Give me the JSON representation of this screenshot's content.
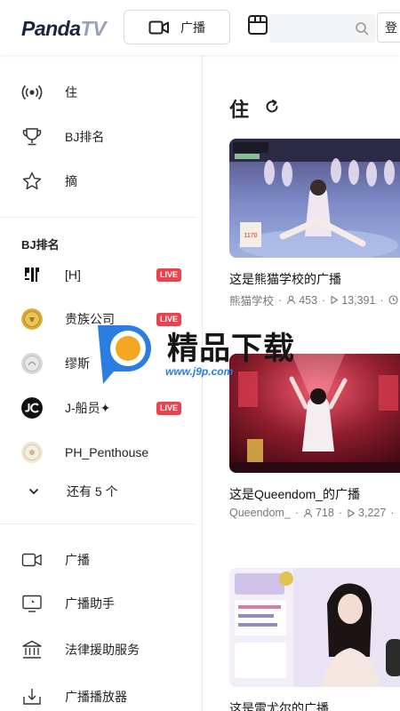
{
  "header": {
    "logo": {
      "part1": "Panda",
      "part2": "TV"
    },
    "broadcast_label": "广播",
    "search_placeholder": "",
    "login_label": "登"
  },
  "sidebar": {
    "nav_top": [
      {
        "label": "住",
        "icon": "live-broadcast-icon"
      },
      {
        "label": "BJ排名",
        "icon": "trophy-icon"
      },
      {
        "label": "摘",
        "icon": "star-icon"
      }
    ],
    "bj_section_title": "BJ排名",
    "bj_list": [
      {
        "name": "[H]",
        "live": true,
        "avatar": "logo-avatar"
      },
      {
        "name": "贵族公司",
        "live": true,
        "avatar": "gold-coin-avatar"
      },
      {
        "name": "缪斯",
        "live": false,
        "avatar": "silver-coin-avatar"
      },
      {
        "name": "J-船员✦",
        "live": true,
        "avatar": "jc-avatar"
      },
      {
        "name": "PH_Penthouse",
        "live": false,
        "avatar": "cream-coin-avatar"
      }
    ],
    "live_badge": "LIVE",
    "more_label": "还有 5 个",
    "nav_bottom": [
      {
        "label": "广播",
        "icon": "video-camera-icon"
      },
      {
        "label": "广播助手",
        "icon": "monitor-icon"
      },
      {
        "label": "法律援助服务",
        "icon": "court-building-icon"
      },
      {
        "label": "广播播放器",
        "icon": "download-icon"
      }
    ]
  },
  "main": {
    "title": "住",
    "cards": [
      {
        "title": "这是熊猫学校的广播",
        "channel": "熊猫学校",
        "viewers": "453",
        "plays": "13,391",
        "thumb_sign": "1170"
      },
      {
        "title": "这是Queendom_的广播",
        "channel": "Queendom_",
        "viewers": "718",
        "plays": "3,227"
      },
      {
        "title": "这是雷尤尔的广播"
      }
    ]
  },
  "watermark": {
    "text": "精品下载",
    "url": "www.j9p.com"
  },
  "colors": {
    "live_red": "#e8434f",
    "watermark_blue": "#2a7de1",
    "watermark_orange": "#f5a623"
  }
}
